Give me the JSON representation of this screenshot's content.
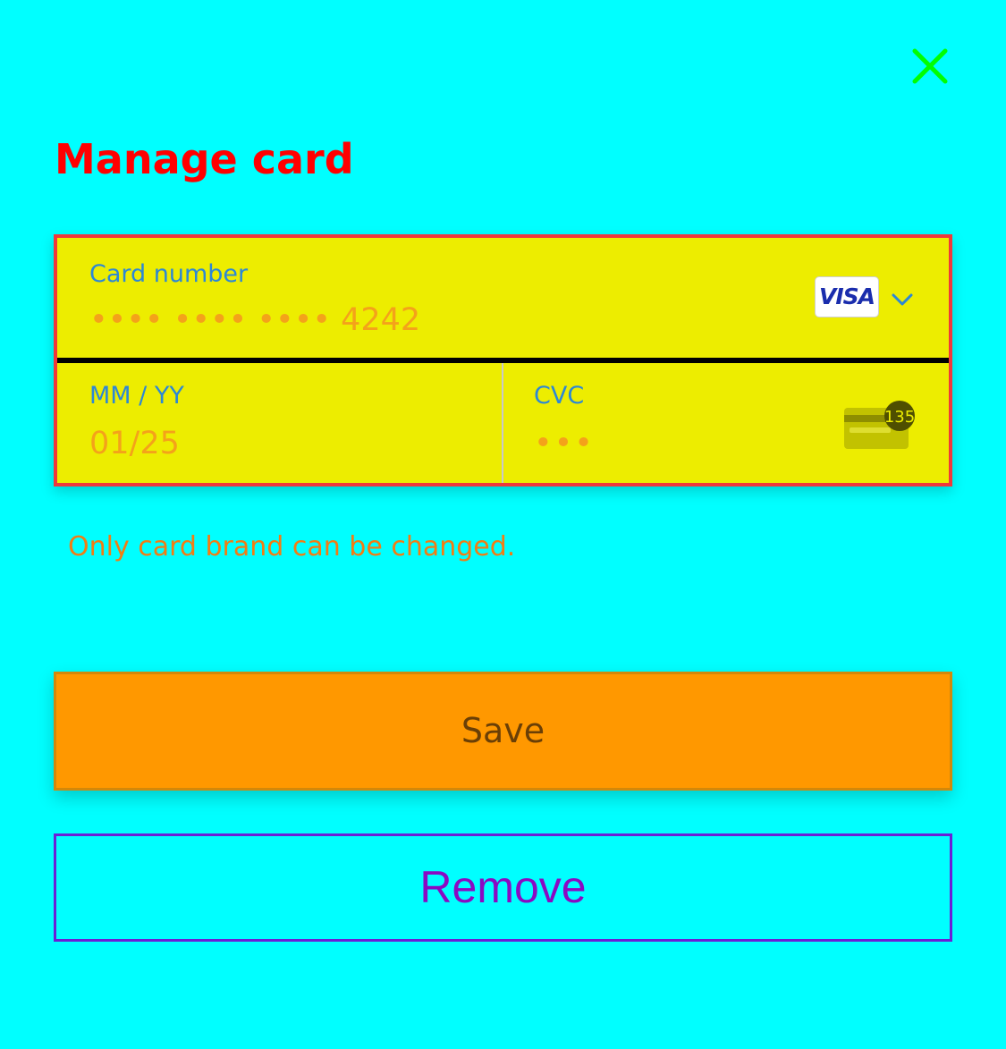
{
  "header": {
    "title": "Manage card",
    "close_icon": "close-icon",
    "close_color": "#00FF00"
  },
  "card_form": {
    "card_number": {
      "label": "Card number",
      "value": "•••• •••• •••• 4242"
    },
    "brand": {
      "name": "VISA",
      "icon": "visa-logo",
      "dropdown_icon": "chevron-down-icon"
    },
    "expiry": {
      "label": "MM / YY",
      "value": "01/25"
    },
    "cvc": {
      "label": "CVC",
      "value": "•••",
      "icon": "card-back-cvc-icon",
      "icon_text": "135"
    }
  },
  "helper_text": "Only card brand can be changed.",
  "buttons": {
    "save_label": "Save",
    "remove_label": "Remove"
  },
  "colors": {
    "background": "#00FFFF",
    "title": "#FF0000",
    "form_background": "#EDED00",
    "form_border": "#F0383A",
    "label": "#2C87D6",
    "value": "#F4A21A",
    "helper": "#F27C13",
    "save_background": "#FF9800",
    "save_text": "#6A3F06",
    "remove_border": "#6B1FD6",
    "remove_text": "#8A0AC2"
  }
}
